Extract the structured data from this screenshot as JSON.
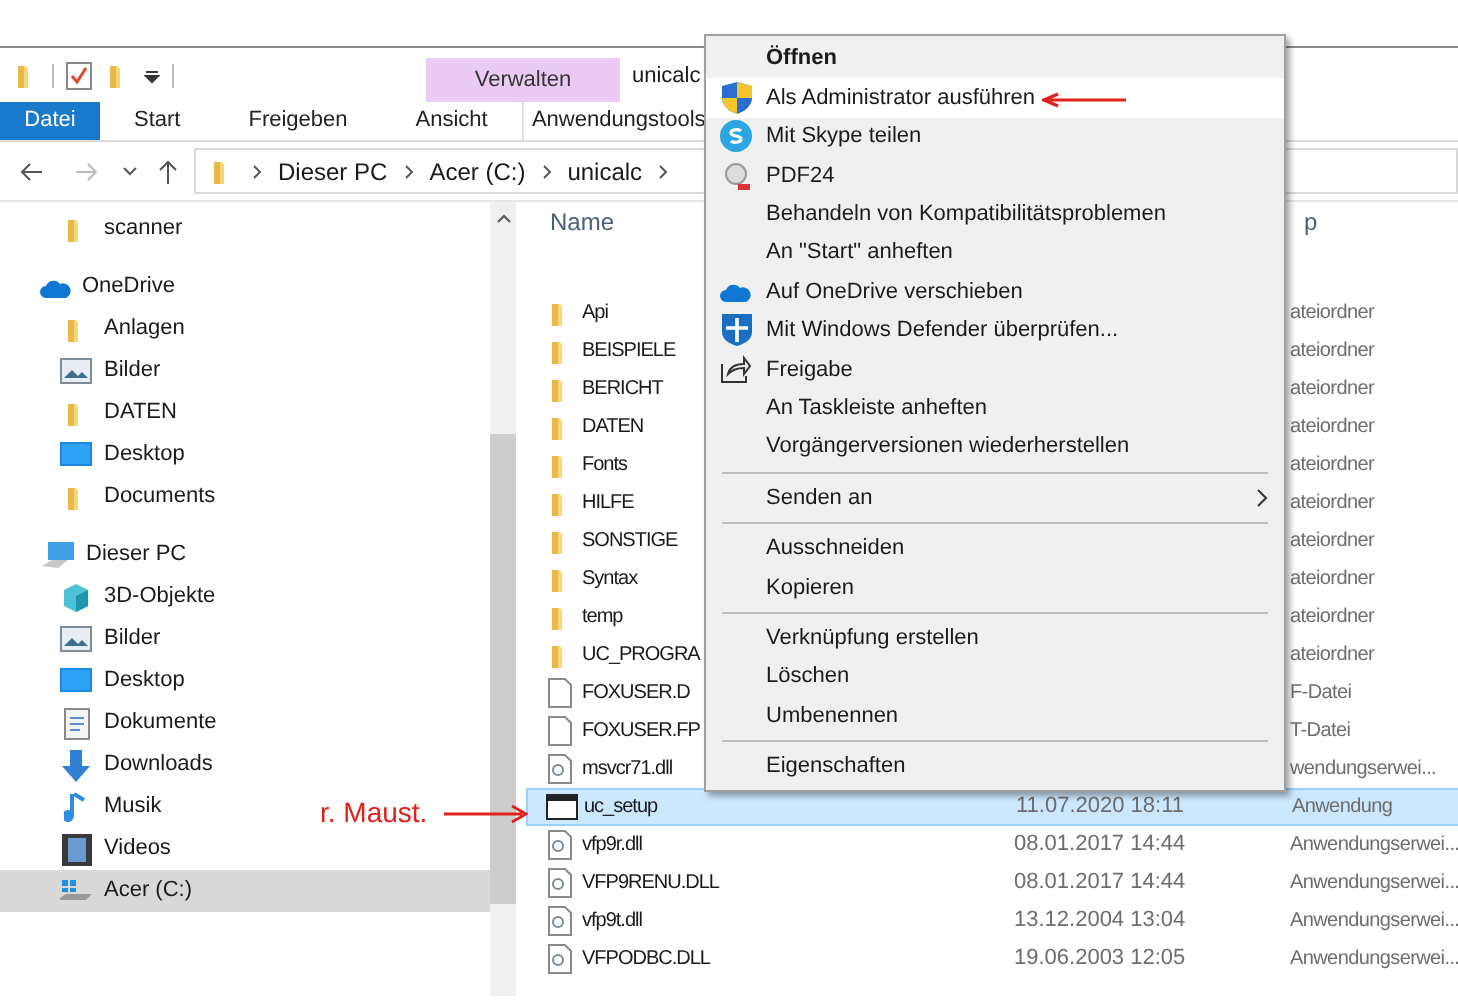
{
  "quick_access": {
    "context_tab": "Verwalten",
    "title": "unicalc"
  },
  "ribbon_tabs": [
    {
      "label": "Datei",
      "kind": "file",
      "selected": false
    },
    {
      "label": "Start",
      "kind": "tab",
      "selected": false
    },
    {
      "label": "Freigeben",
      "kind": "tab",
      "selected": false
    },
    {
      "label": "Ansicht",
      "kind": "tab",
      "selected": false
    },
    {
      "label": "Anwendungstools",
      "kind": "context",
      "selected": false
    }
  ],
  "address": {
    "crumbs": [
      "Dieser PC",
      "Acer (C:)",
      "unicalc"
    ]
  },
  "nav": [
    {
      "children": [
        {
          "label": "scanner",
          "kind": "folder",
          "selected": false
        }
      ]
    },
    {
      "label": "OneDrive",
      "kind": "cloud",
      "children": [
        {
          "label": "Anlagen",
          "kind": "folder",
          "selected": false
        },
        {
          "label": "Bilder",
          "kind": "pictures",
          "selected": false
        },
        {
          "label": "DATEN",
          "kind": "folder",
          "selected": false
        },
        {
          "label": "Desktop",
          "kind": "desktop",
          "selected": false
        },
        {
          "label": "Documents",
          "kind": "folder",
          "selected": false
        }
      ]
    },
    {
      "label": "Dieser PC",
      "kind": "pc",
      "children": [
        {
          "label": "3D-Objekte",
          "kind": "cube",
          "selected": false
        },
        {
          "label": "Bilder",
          "kind": "pictures",
          "selected": false
        },
        {
          "label": "Desktop",
          "kind": "desktop",
          "selected": false
        },
        {
          "label": "Dokumente",
          "kind": "document",
          "selected": false
        },
        {
          "label": "Downloads",
          "kind": "download",
          "selected": false
        },
        {
          "label": "Musik",
          "kind": "music",
          "selected": false
        },
        {
          "label": "Videos",
          "kind": "film",
          "selected": false
        },
        {
          "label": "Acer (C:)",
          "kind": "drive",
          "selected": true
        }
      ]
    }
  ],
  "columns": [
    "Name",
    "p"
  ],
  "files": [
    {
      "name": "Api",
      "kind": "folder",
      "type": "ateiordner",
      "selected": false
    },
    {
      "name": "BEISPIELE",
      "kind": "folder",
      "type": "ateiordner",
      "selected": false
    },
    {
      "name": "BERICHT",
      "kind": "folder",
      "type": "ateiordner",
      "selected": false
    },
    {
      "name": "DATEN",
      "kind": "folder",
      "type": "ateiordner",
      "selected": false
    },
    {
      "name": "Fonts",
      "kind": "folder",
      "type": "ateiordner",
      "selected": false
    },
    {
      "name": "HILFE",
      "kind": "folder",
      "type": "ateiordner",
      "selected": false
    },
    {
      "name": "SONSTIGE",
      "kind": "folder",
      "type": "ateiordner",
      "selected": false
    },
    {
      "name": "Syntax",
      "kind": "folder",
      "type": "ateiordner",
      "selected": false
    },
    {
      "name": "temp",
      "kind": "folder",
      "type": "ateiordner",
      "selected": false
    },
    {
      "name": "UC_PROGRA",
      "kind": "folder",
      "type": "ateiordner",
      "selected": false
    },
    {
      "name": "FOXUSER.D",
      "kind": "file",
      "type": "F-Datei",
      "selected": false
    },
    {
      "name": "FOXUSER.FP",
      "kind": "file",
      "type": "T-Datei",
      "selected": false
    },
    {
      "name": "msvcr71.dll",
      "kind": "dll",
      "type": "wendungserwei...",
      "selected": false
    },
    {
      "name": "uc_setup",
      "kind": "app",
      "date": "11.07.2020 18:11",
      "type": "Anwendung",
      "selected": true
    },
    {
      "name": "vfp9r.dll",
      "kind": "dll",
      "date": "08.01.2017 14:44",
      "type": "Anwendungserwei...",
      "selected": false
    },
    {
      "name": "VFP9RENU.DLL",
      "kind": "dll",
      "date": "08.01.2017 14:44",
      "type": "Anwendungserwei...",
      "selected": false
    },
    {
      "name": "vfp9t.dll",
      "kind": "dll",
      "date": "13.12.2004 13:04",
      "type": "Anwendungserwei...",
      "selected": false
    },
    {
      "name": "VFPODBC.DLL",
      "kind": "dll",
      "date": "19.06.2003 12:05",
      "type": "Anwendungserwei...",
      "selected": false
    }
  ],
  "context_menu": [
    {
      "kind": "text",
      "label": "Öffnen",
      "bold": true,
      "selected": false
    },
    {
      "kind": "shield",
      "label": "Als Administrator ausführen",
      "selected": true
    },
    {
      "kind": "skype",
      "label": "Mit Skype teilen",
      "selected": false
    },
    {
      "kind": "pdf",
      "label": "PDF24",
      "selected": false
    },
    {
      "kind": "text",
      "label": "Behandeln von Kompatibilitätsproblemen",
      "selected": false
    },
    {
      "kind": "text",
      "label": "An \"Start\" anheften",
      "selected": false
    },
    {
      "kind": "cloud",
      "label": "Auf OneDrive verschieben",
      "selected": false
    },
    {
      "kind": "defender",
      "label": "Mit Windows Defender überprüfen...",
      "selected": false
    },
    {
      "kind": "share",
      "label": "Freigabe",
      "selected": false
    },
    {
      "kind": "text",
      "label": "An Taskleiste anheften",
      "selected": false
    },
    {
      "kind": "text",
      "label": "Vorgängerversionen wiederherstellen",
      "selected": false
    },
    {
      "kind": "separator"
    },
    {
      "kind": "text",
      "label": "Senden an",
      "submenu": true,
      "selected": false
    },
    {
      "kind": "separator"
    },
    {
      "kind": "text",
      "label": "Ausschneiden",
      "selected": false
    },
    {
      "kind": "text",
      "label": "Kopieren",
      "selected": false
    },
    {
      "kind": "separator"
    },
    {
      "kind": "text",
      "label": "Verknüpfung erstellen",
      "selected": false
    },
    {
      "kind": "text",
      "label": "Löschen",
      "selected": false
    },
    {
      "kind": "text",
      "label": "Umbenennen",
      "selected": false
    },
    {
      "kind": "separator"
    },
    {
      "kind": "text",
      "label": "Eigenschaften",
      "selected": false
    }
  ],
  "annotation": {
    "text": "r. Maust."
  }
}
